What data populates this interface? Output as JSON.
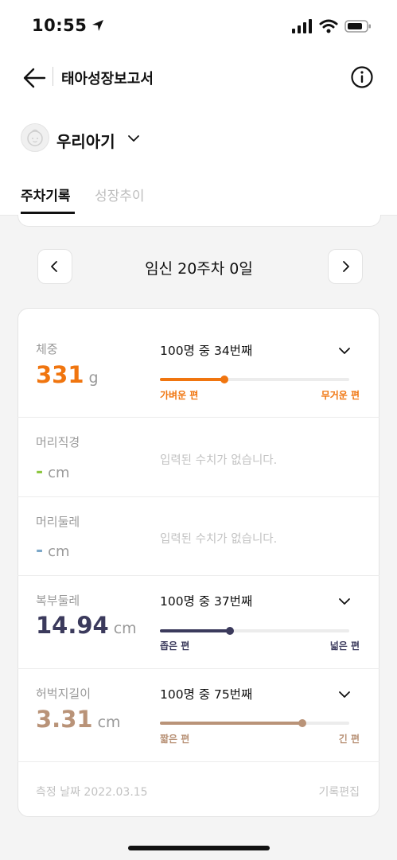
{
  "status_bar": {
    "time": "10:55"
  },
  "header": {
    "title": "태아성장보고서"
  },
  "baby": {
    "name": "우리아기"
  },
  "tabs": [
    {
      "label": "주차기록",
      "active": true
    },
    {
      "label": "성장추이",
      "active": false
    }
  ],
  "week": {
    "label": "임신 20주차 0일"
  },
  "metrics": {
    "weight": {
      "label": "체중",
      "value": "331",
      "unit": "g",
      "rank": "100명 중 34번째",
      "percentile": 0.34,
      "low_label": "가벼운 편",
      "high_label": "무거운 편",
      "color": "#f0750f"
    },
    "head_diameter": {
      "label": "머리직경",
      "value": "-",
      "unit": "cm",
      "empty_message": "입력된 수치가 없습니다.",
      "color": "#8cc63f"
    },
    "head_circumference": {
      "label": "머리둘레",
      "value": "-",
      "unit": "cm",
      "empty_message": "입력된 수치가 없습니다.",
      "color": "#7ba7c8"
    },
    "abdomen_circumference": {
      "label": "복부둘레",
      "value": "14.94",
      "unit": "cm",
      "rank": "100명 중 37번째",
      "percentile": 0.37,
      "low_label": "좁은 편",
      "high_label": "넓은 편",
      "color": "#3b3a5c"
    },
    "femur_length": {
      "label": "허벅지길이",
      "value": "3.31",
      "unit": "cm",
      "rank": "100명 중 75번째",
      "percentile": 0.75,
      "low_label": "짧은 편",
      "high_label": "긴 편",
      "color": "#b99378"
    }
  },
  "footer": {
    "measured_date": "측정 날짜 2022.03.15",
    "edit_label": "기록편집"
  },
  "icons": {
    "back": "arrow-left-icon",
    "info": "info-circle-icon",
    "avatar": "baby-face-icon",
    "dropdown": "chevron-down-icon",
    "prev": "chevron-left-icon",
    "next": "chevron-right-icon"
  }
}
